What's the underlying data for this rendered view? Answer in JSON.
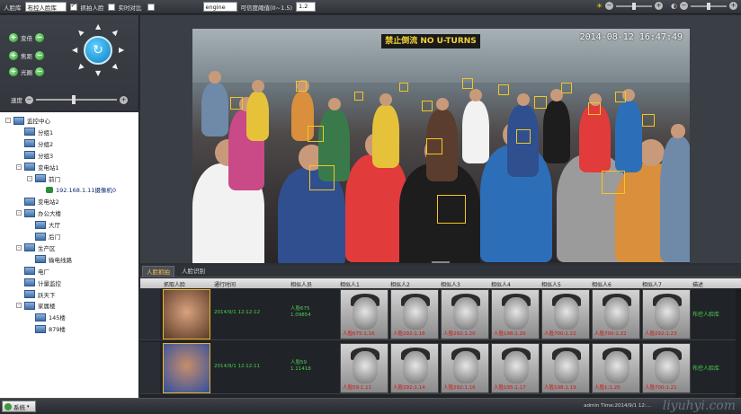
{
  "toolbar": {
    "face_db_label": "人脸库",
    "face_db_value": "布控人脸库",
    "capture_label": "抓拍人脸",
    "realtime_label": "实时对比",
    "engine_value": "engine",
    "threshold_label": "可信度阈值(0~1.5)",
    "threshold_value": "1.2"
  },
  "ptz": {
    "buttons": [
      "变倍",
      "焦距",
      "光圈"
    ],
    "speed_label": "速度"
  },
  "tree": {
    "nodes": [
      {
        "label": "监控中心",
        "level": 0,
        "toggle": "-",
        "ip": false
      },
      {
        "label": "分组1",
        "level": 1,
        "toggle": "",
        "ip": false
      },
      {
        "label": "分组2",
        "level": 1,
        "toggle": "",
        "ip": false
      },
      {
        "label": "分组3",
        "level": 1,
        "toggle": "",
        "ip": false
      },
      {
        "label": "变电站1",
        "level": 1,
        "toggle": "-",
        "ip": false
      },
      {
        "label": "前门",
        "level": 2,
        "toggle": "-",
        "ip": false
      },
      {
        "label": "192.168.1.11摄像机0",
        "level": 3,
        "toggle": "",
        "ip": true
      },
      {
        "label": "变电站2",
        "level": 1,
        "toggle": "",
        "ip": false
      },
      {
        "label": "办公大楼",
        "level": 1,
        "toggle": "-",
        "ip": false
      },
      {
        "label": "大厅",
        "level": 2,
        "toggle": "",
        "ip": false
      },
      {
        "label": "后门",
        "level": 2,
        "toggle": "",
        "ip": false
      },
      {
        "label": "生产区",
        "level": 1,
        "toggle": "-",
        "ip": false
      },
      {
        "label": "输电线路",
        "level": 2,
        "toggle": "",
        "ip": false
      },
      {
        "label": "电厂",
        "level": 1,
        "toggle": "",
        "ip": false
      },
      {
        "label": "计量监控",
        "level": 1,
        "toggle": "",
        "ip": false
      },
      {
        "label": "跃天下",
        "level": 1,
        "toggle": "",
        "ip": false
      },
      {
        "label": "家属楼",
        "level": 1,
        "toggle": "-",
        "ip": false
      },
      {
        "label": "145楼",
        "level": 2,
        "toggle": "",
        "ip": false
      },
      {
        "label": "879楼",
        "level": 2,
        "toggle": "",
        "ip": false
      }
    ]
  },
  "video": {
    "sign_text": "禁止倒流 NO U-TURNS",
    "timestamp": "2014-08-12 16:47:49"
  },
  "tabs": [
    "人脸抓拍",
    "人脸识别"
  ],
  "table": {
    "headers": [
      "抓取人脸",
      "通行时间",
      "相似人员",
      "相似人1",
      "相似人2",
      "相似人3",
      "相似人4",
      "相似人5",
      "相似人6",
      "相似人7",
      "描述"
    ],
    "rows": [
      {
        "time": "2014/9/1 12:12:12",
        "match_name": "人脸675",
        "match_score": "1.09854",
        "sims": [
          "人脸675:1.16",
          "人脸292:1.18",
          "人脸292:1.20",
          "人脸198:1.20",
          "人脸700:1.22",
          "人脸700:1.22",
          "人脸292:1.23"
        ],
        "desc": "布控人脸库"
      },
      {
        "time": "2014/9/1 12:12:11",
        "match_name": "人脸59",
        "match_score": "1.11418",
        "sims": [
          "人脸59:1.11",
          "人脸292:1.14",
          "人脸292:1.16",
          "人脸195:1.17",
          "人脸198:1.19",
          "人脸1:1.20",
          "人脸700:1.21"
        ],
        "desc": "布控人脸库"
      }
    ]
  },
  "statusbar": {
    "system_label": "系统",
    "status_text": "admin  Time:2014/9/1 12:...",
    "watermark": "liyuhyi.com"
  }
}
